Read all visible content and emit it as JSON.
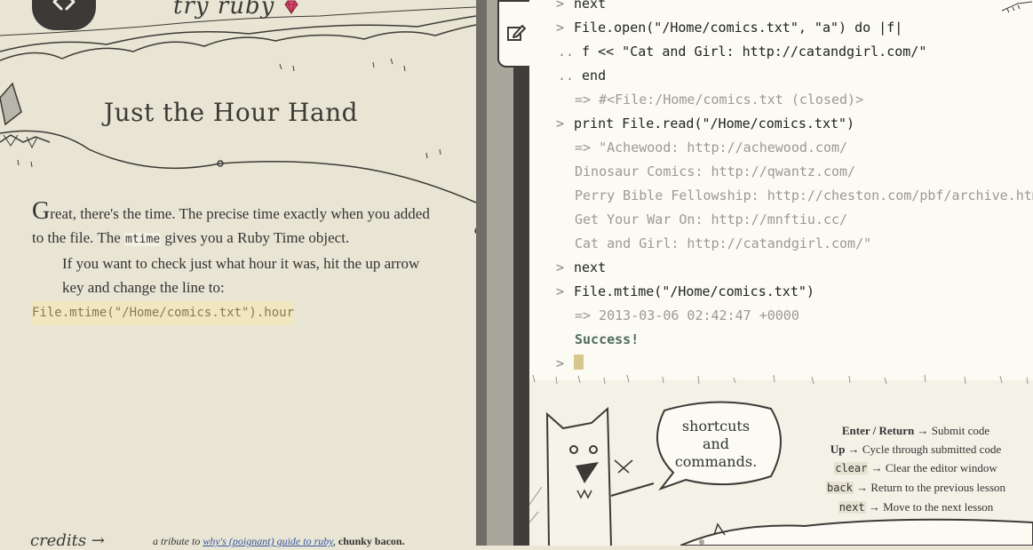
{
  "brand": "try ruby",
  "lesson": {
    "title": "Just the Hour Hand",
    "p1_dropcap": "G",
    "p1_a": "reat, there's the time. The precise time exactly when you added to the file. The ",
    "p1_code": "mtime",
    "p1_b": " gives you a Ruby Time object.",
    "p2": "If you want to check just what hour it was, hit the up arrow key and change the line to:",
    "code": "File.mtime(\"/Home/comics.txt\").hour"
  },
  "footer": {
    "credits": "credits →",
    "tribute_prefix": "a tribute to ",
    "tribute_link": "why's (poignant) guide to ruby",
    "tribute_suffix": ", ",
    "chunky": "chunky bacon."
  },
  "console": {
    "lines": [
      {
        "kind": "input",
        "prompt": ">",
        "text": "next"
      },
      {
        "kind": "input",
        "prompt": ">",
        "text": "File.open(\"/Home/comics.txt\", \"a\") do |f|"
      },
      {
        "kind": "input",
        "prompt": "..",
        "text": " f << \"Cat and Girl: http://catandgirl.com/\""
      },
      {
        "kind": "input",
        "prompt": "..",
        "text": " end"
      },
      {
        "kind": "output",
        "prompt": "",
        "text": "=> #<File:/Home/comics.txt (closed)>"
      },
      {
        "kind": "input",
        "prompt": ">",
        "text": "print File.read(\"/Home/comics.txt\")"
      },
      {
        "kind": "output",
        "prompt": "",
        "text": "=> \"Achewood: http://achewood.com/"
      },
      {
        "kind": "output",
        "prompt": "",
        "text": "Dinosaur Comics: http://qwantz.com/"
      },
      {
        "kind": "output",
        "prompt": "",
        "text": "Perry Bible Fellowship: http://cheston.com/pbf/archive.html"
      },
      {
        "kind": "output",
        "prompt": "",
        "text": "Get Your War On: http://mnftiu.cc/"
      },
      {
        "kind": "output",
        "prompt": "",
        "text": "Cat and Girl: http://catandgirl.com/\""
      },
      {
        "kind": "input",
        "prompt": ">",
        "text": "next"
      },
      {
        "kind": "input",
        "prompt": ">",
        "text": "File.mtime(\"/Home/comics.txt\")"
      },
      {
        "kind": "output",
        "prompt": "",
        "text": "=> 2013-03-06 02:42:47 +0000"
      },
      {
        "kind": "success",
        "prompt": "",
        "text": "Success!"
      },
      {
        "kind": "input",
        "prompt": ">",
        "text": ""
      }
    ]
  },
  "shortcuts": {
    "bubble_line1": "shortcuts",
    "bubble_line2": "and",
    "bubble_line3": "commands.",
    "items": [
      {
        "key": "Enter / Return",
        "desc": "Submit code",
        "style": "bold"
      },
      {
        "key": "Up",
        "desc": "Cycle through submitted code",
        "style": "bold"
      },
      {
        "key": "clear",
        "desc": "Clear the editor window",
        "style": "code"
      },
      {
        "key": "back",
        "desc": "Return to the previous lesson",
        "style": "code"
      },
      {
        "key": "next",
        "desc": "Move to the next lesson",
        "style": "code"
      }
    ],
    "arrow": "→"
  },
  "colors": {
    "paper": "#e8e5d4",
    "console_bg": "#fbfaf3",
    "code_highlight": "#f0e6bf",
    "success": "#4f6b5e",
    "link": "#3a55a0"
  },
  "icons": [
    "code-brackets-icon",
    "ruby-gem-icon",
    "edit-icon",
    "kite-icon",
    "fox-icon",
    "cat-character-icon"
  ]
}
